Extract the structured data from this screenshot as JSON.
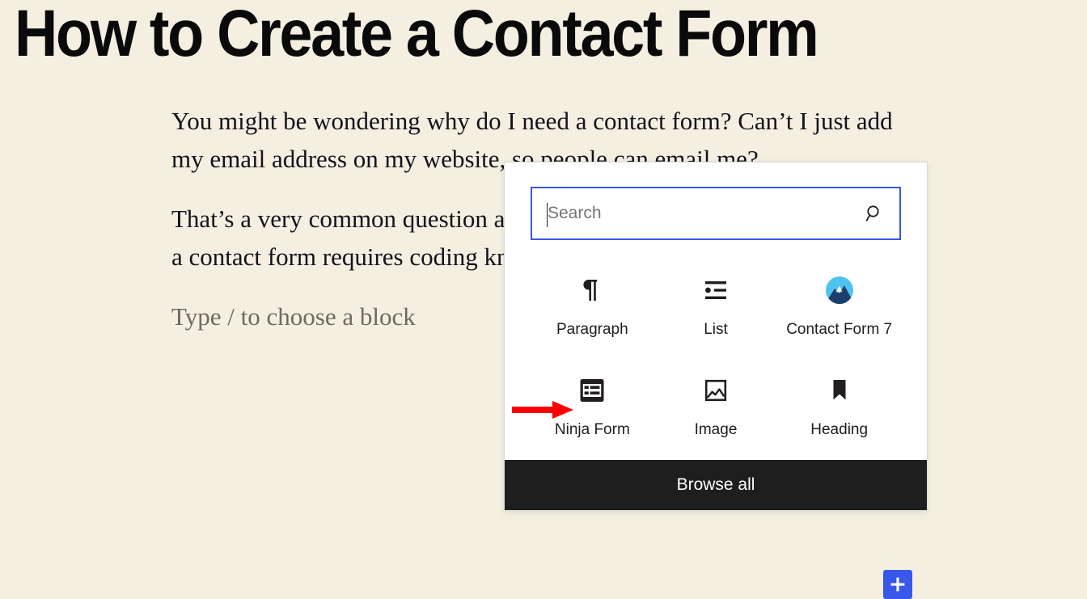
{
  "editor": {
    "post_title": "How to Create a Contact Form",
    "paragraphs": [
      "You might be wondering why do I need a contact form? Can’t I just add my email address on my website, so people can email me?",
      "That’s a very common question and many beginners are afraid that adding a contact form requires coding knowledge."
    ],
    "empty_block_placeholder": "Type / to choose a block",
    "background_color": "#f5efe2",
    "text_color": "#12131a"
  },
  "inserter": {
    "search": {
      "value": "",
      "placeholder": "Search",
      "icon": "search-icon",
      "focus_border_color": "#3858e9"
    },
    "blocks": [
      {
        "label": "Paragraph",
        "icon": "paragraph-icon"
      },
      {
        "label": "List",
        "icon": "list-icon"
      },
      {
        "label": "Contact Form 7",
        "icon": "contact-form-7-icon"
      },
      {
        "label": "Ninja Form",
        "icon": "ninja-form-icon"
      },
      {
        "label": "Image",
        "icon": "image-icon"
      },
      {
        "label": "Heading",
        "icon": "heading-icon"
      }
    ],
    "browse_all_label": "Browse all",
    "browse_all_bg": "#1e1e1e",
    "panel_bg": "#ffffff"
  },
  "annotation": {
    "arrow": {
      "icon": "right-arrow-icon",
      "color": "#ff0000",
      "points_to": "Ninja Form"
    }
  },
  "add_block_button": {
    "icon": "plus-icon",
    "color": "#3858e9"
  }
}
